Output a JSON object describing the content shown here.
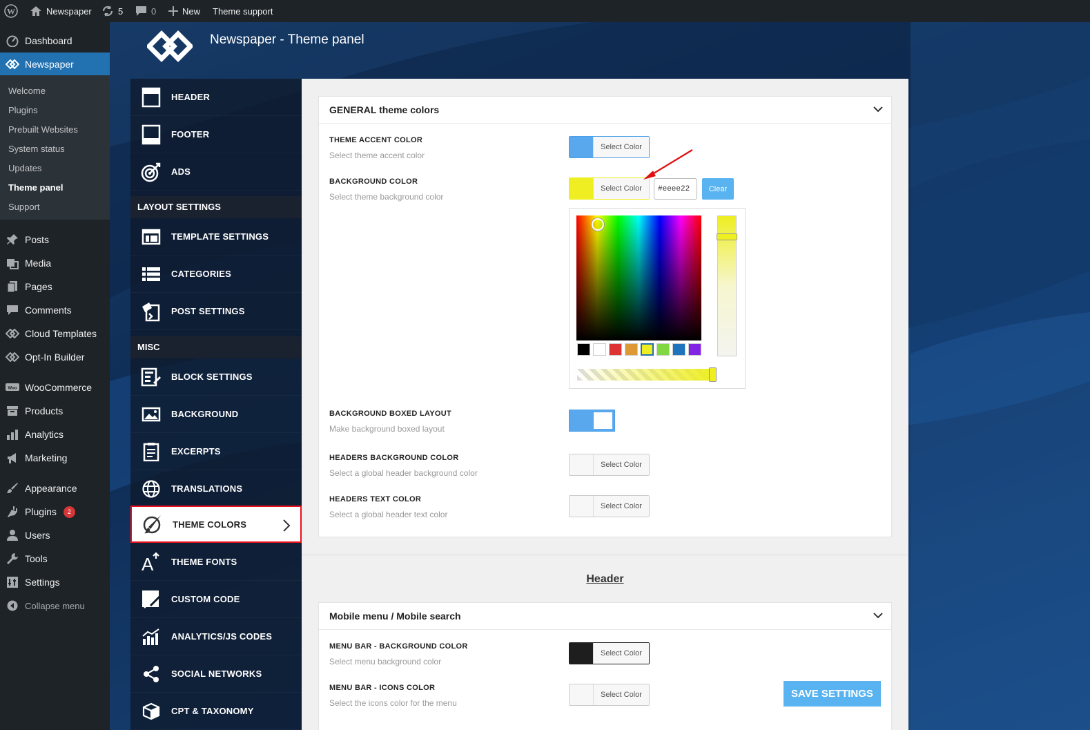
{
  "adminbar": {
    "site_name": "Newspaper",
    "updates_count": "5",
    "comments_count": "0",
    "new_label": "New",
    "support_label": "Theme support"
  },
  "wp_menu": {
    "dashboard": "Dashboard",
    "newspaper": "Newspaper",
    "submenu": [
      "Welcome",
      "Plugins",
      "Prebuilt Websites",
      "System status",
      "Updates",
      "Theme panel",
      "Support"
    ],
    "items": [
      "Posts",
      "Media",
      "Pages",
      "Comments",
      "Cloud Templates",
      "Opt-In Builder",
      "WooCommerce",
      "Products",
      "Analytics",
      "Marketing",
      "Appearance",
      "Plugins",
      "Users",
      "Tools",
      "Settings",
      "Collapse menu"
    ],
    "plugins_badge": "2"
  },
  "panel": {
    "title": "Newspaper - Theme panel"
  },
  "nav": {
    "items_top": [
      "HEADER",
      "FOOTER",
      "ADS"
    ],
    "section_layout": "LAYOUT SETTINGS",
    "items_layout": [
      "TEMPLATE SETTINGS",
      "CATEGORIES",
      "POST SETTINGS"
    ],
    "section_misc": "MISC",
    "items_misc": [
      "BLOCK SETTINGS",
      "BACKGROUND",
      "EXCERPTS",
      "TRANSLATIONS",
      "THEME COLORS",
      "THEME FONTS",
      "CUSTOM CODE",
      "ANALYTICS/JS CODES",
      "SOCIAL NETWORKS",
      "CPT & TAXONOMY"
    ]
  },
  "general_box": {
    "title": "GENERAL theme colors",
    "rows": [
      {
        "title": "THEME ACCENT COLOR",
        "desc": "Select theme accent color"
      },
      {
        "title": "BACKGROUND COLOR",
        "desc": "Select theme background color"
      },
      {
        "title": "BACKGROUND BOXED LAYOUT",
        "desc": "Make background boxed layout"
      },
      {
        "title": "HEADERS BACKGROUND COLOR",
        "desc": "Select a global header background color"
      },
      {
        "title": "HEADERS TEXT COLOR",
        "desc": "Select a global header text color"
      }
    ],
    "select_color_label": "Select Color",
    "hex_value": "#eeee22",
    "clear_label": "Clear",
    "accent_color": "#4a9fe8",
    "background_color": "#eeee22",
    "boxed_layout_on": true,
    "palette": [
      "#000000",
      "#ffffff",
      "#dd3333",
      "#dd9933",
      "#eeee22",
      "#81d742",
      "#1e73be",
      "#8224e3"
    ]
  },
  "section_heading": "Header",
  "mobile_box": {
    "title": "Mobile menu / Mobile search",
    "rows": [
      {
        "title": "MENU BAR - BACKGROUND COLOR",
        "desc": "Select menu background color"
      },
      {
        "title": "MENU BAR - ICONS COLOR",
        "desc": "Select the icons color for the menu"
      }
    ],
    "menu_bg_color": "#1e1e1e"
  },
  "save_label": "SAVE SETTINGS"
}
